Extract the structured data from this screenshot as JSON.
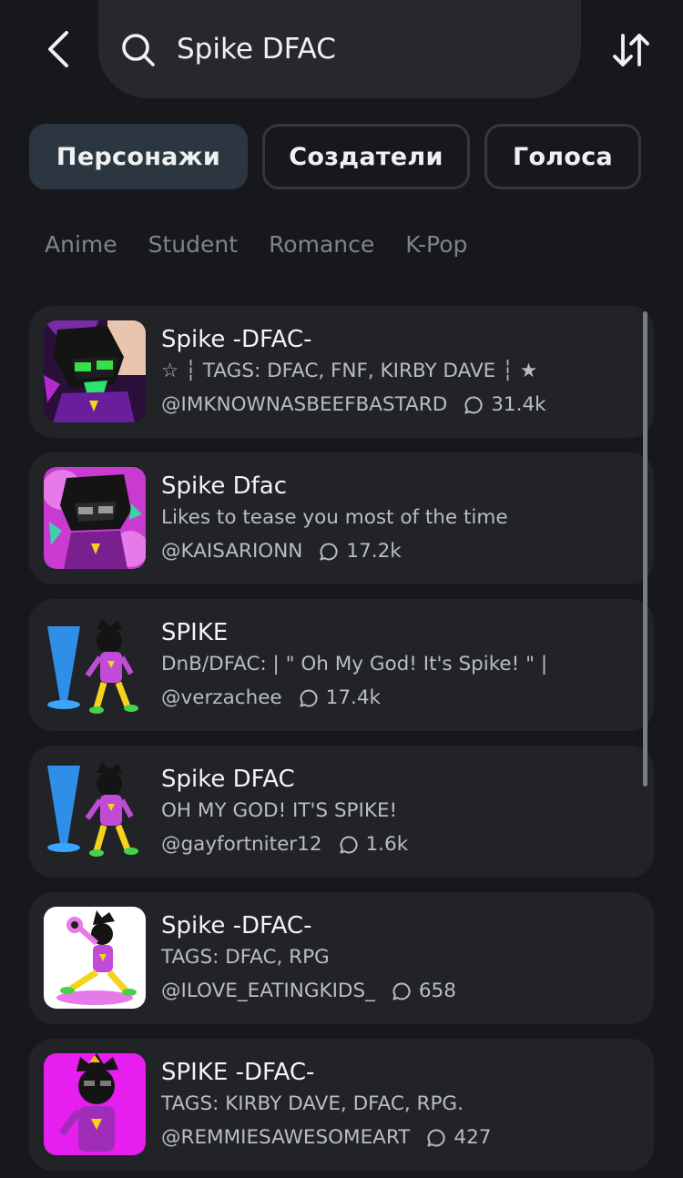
{
  "search": {
    "query": "Spike DFAC"
  },
  "tabs": [
    {
      "label": "Персонажи",
      "active": true
    },
    {
      "label": "Создатели",
      "active": false
    },
    {
      "label": "Голоса",
      "active": false
    }
  ],
  "chips": [
    "Anime",
    "Student",
    "Romance",
    "K-Pop"
  ],
  "results": [
    {
      "name": "Spike -DFAC-",
      "description": "☆ ┆ TAGS: DFAC, FNF, KIRBY DAVE ┆ ★",
      "creator": "@IMKNOWNASBEEFBASTARD",
      "chats": "31.4k"
    },
    {
      "name": "Spike Dfac",
      "description": "Likes to tease you most of the time",
      "creator": "@KAISARIONN",
      "chats": "17.2k"
    },
    {
      "name": "SPIKE",
      "description": "DnB/DFAC: | \" Oh My God! It's Spike! \" |",
      "creator": "@verzachee",
      "chats": "17.4k"
    },
    {
      "name": "Spike DFAC",
      "description": "OH MY GOD! IT'S SPIKE!",
      "creator": "@gayfortniter12",
      "chats": "1.6k"
    },
    {
      "name": "Spike -DFAC-",
      "description": "TAGS: DFAC, RPG",
      "creator": "@ILOVE_EATINGKIDS_",
      "chats": "658"
    },
    {
      "name": "SPIKE -DFAC-",
      "description": "TAGS: KIRBY DAVE, DFAC, RPG.",
      "creator": "@REMMIESAWESOMEART",
      "chats": "427"
    }
  ],
  "colors": {
    "background": "#17181b",
    "card": "#212327",
    "active_tab": "#2c3640",
    "muted_text": "#7f848b"
  }
}
